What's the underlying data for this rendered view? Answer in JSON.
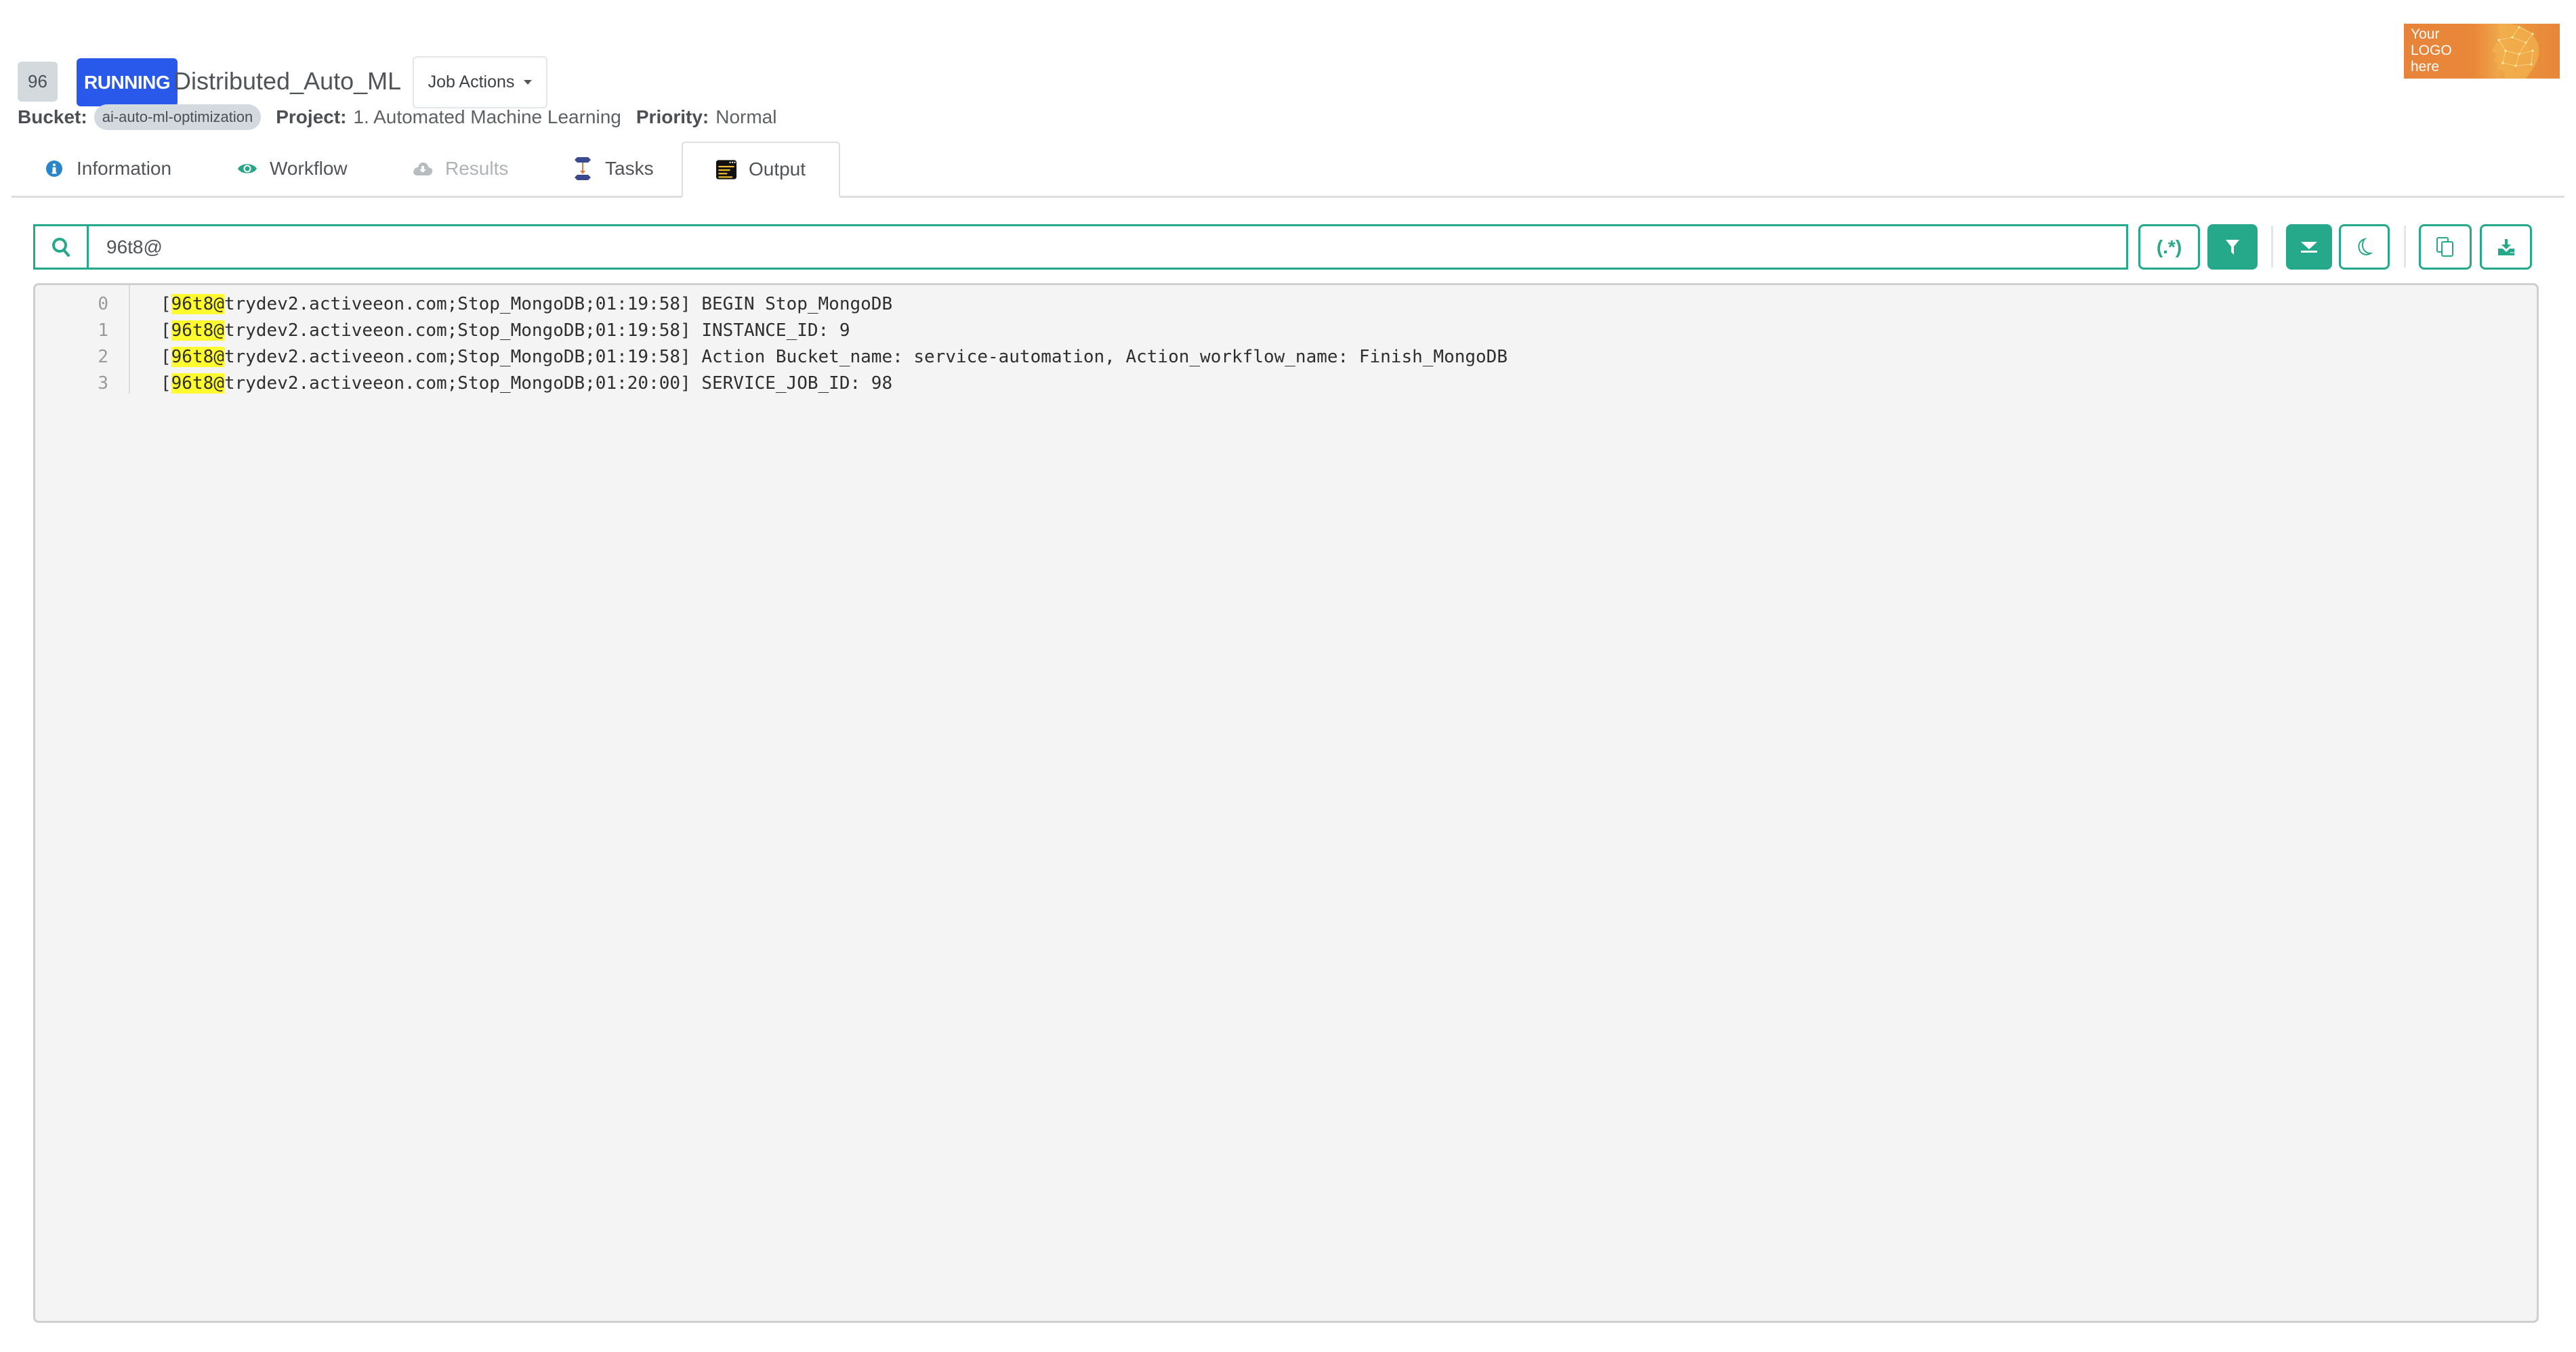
{
  "header": {
    "job_id": "96",
    "status": "RUNNING",
    "title": "Distributed_Auto_ML",
    "job_actions_label": "Job Actions",
    "status_color": "#2859eb"
  },
  "meta": {
    "bucket_label": "Bucket:",
    "bucket_value": "ai-auto-ml-optimization",
    "project_label": "Project:",
    "project_value": "1. Automated Machine Learning",
    "priority_label": "Priority:",
    "priority_value": "Normal"
  },
  "logo": {
    "lines": [
      "Your",
      "LOGO",
      "here"
    ]
  },
  "tabs": [
    {
      "label": "Information",
      "icon": "info-circle-icon",
      "state": "normal"
    },
    {
      "label": "Workflow",
      "icon": "eye-icon",
      "state": "normal"
    },
    {
      "label": "Results",
      "icon": "cloud-download-icon",
      "state": "disabled"
    },
    {
      "label": "Tasks",
      "icon": "task-flow-icon",
      "state": "normal"
    },
    {
      "label": "Output",
      "icon": "terminal-output-icon",
      "state": "active"
    }
  ],
  "search": {
    "icon": "search-icon",
    "value": "96t8@",
    "accent_color": "#26a88a"
  },
  "toolbar": {
    "regex_label": "(.*)",
    "regex_active": false,
    "filter_active": true,
    "scroll_bottom_active": true,
    "dark_mode_active": false,
    "buttons": [
      "regex-toggle",
      "filter-toggle",
      "scroll-to-bottom",
      "dark-mode-toggle",
      "copy",
      "download"
    ]
  },
  "output": {
    "highlight_term": "96t8@",
    "highlight_color": "#fffb2e",
    "lines": [
      {
        "number": "0",
        "prefix": "[",
        "match": "96t8@",
        "rest": "trydev2.activeeon.com;Stop_MongoDB;01:19:58] BEGIN Stop_MongoDB"
      },
      {
        "number": "1",
        "prefix": "[",
        "match": "96t8@",
        "rest": "trydev2.activeeon.com;Stop_MongoDB;01:19:58] INSTANCE_ID: 9"
      },
      {
        "number": "2",
        "prefix": "[",
        "match": "96t8@",
        "rest": "trydev2.activeeon.com;Stop_MongoDB;01:19:58] Action Bucket_name: service-automation, Action_workflow_name: Finish_MongoDB"
      },
      {
        "number": "3",
        "prefix": "[",
        "match": "96t8@",
        "rest": "trydev2.activeeon.com;Stop_MongoDB;01:20:00] SERVICE_JOB_ID: 98"
      }
    ]
  }
}
